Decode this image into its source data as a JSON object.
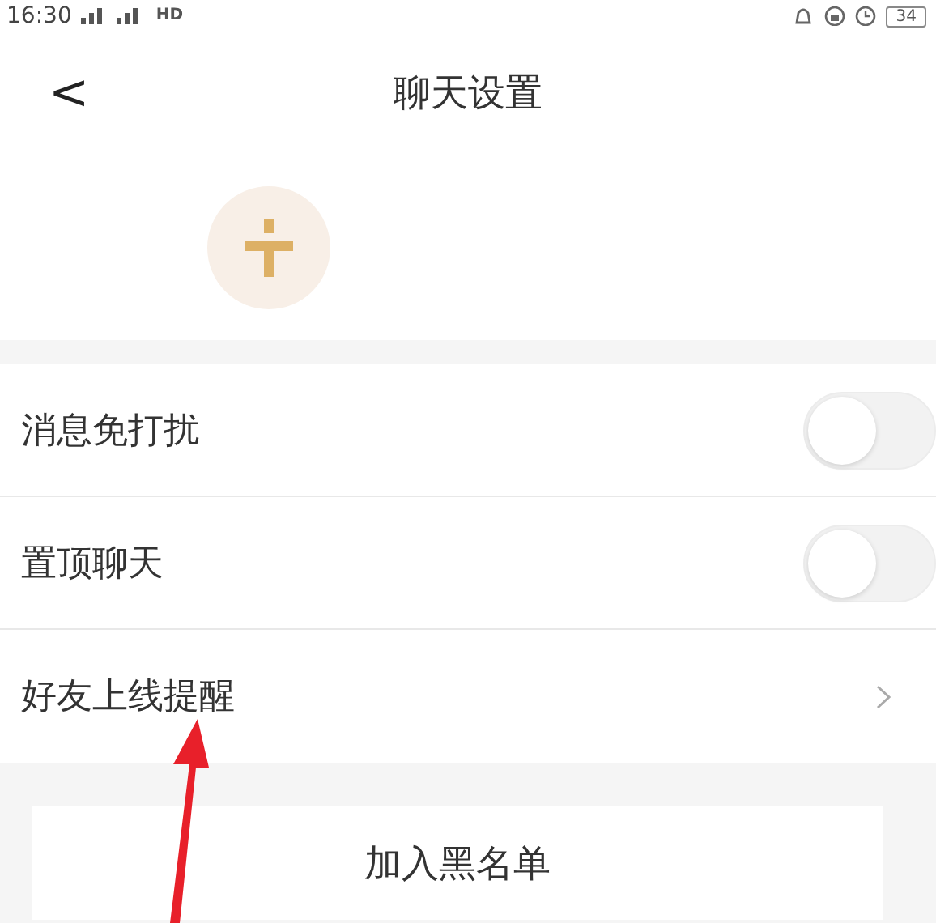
{
  "status_bar": {
    "time": "16:30",
    "network": "HD",
    "battery": "34"
  },
  "header": {
    "back": "<",
    "title": "聊天设置"
  },
  "settings": [
    {
      "kind": "toggle",
      "label": "消息免打扰",
      "on": false
    },
    {
      "kind": "toggle",
      "label": "置顶聊天",
      "on": false
    },
    {
      "kind": "link",
      "label": "好友上线提醒"
    }
  ],
  "blacklist_button": "加入黑名单"
}
